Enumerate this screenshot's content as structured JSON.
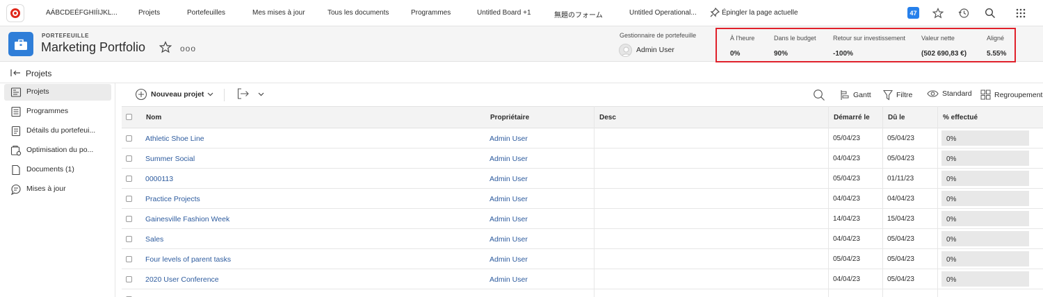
{
  "topnav": {
    "items": [
      "AÁBCDEÉFGHIÍIJKL...",
      "Projets",
      "Portefeuilles",
      "Mes mises à jour",
      "Tous les documents",
      "Programmes",
      "Untitled Board +1",
      "無題のフォーム",
      "Untitled Operational..."
    ],
    "pin_label": "Épingler la page actuelle",
    "notification_count": "47"
  },
  "header": {
    "kicker": "PORTEFEUILLE",
    "title": "Marketing Portfolio",
    "more": "ooo",
    "manager_label": "Gestionnaire de portefeuille",
    "manager_name": "Admin User",
    "metrics": [
      {
        "label": "À l'heure",
        "value": "0%"
      },
      {
        "label": "Dans le budget",
        "value": "90%"
      },
      {
        "label": "Retour sur investissement",
        "value": "-100%"
      },
      {
        "label": "Valeur nette",
        "value": "(502 690,83 €)"
      },
      {
        "label": "Aligné",
        "value": "5.55%"
      }
    ],
    "accent_color": "#e0202a"
  },
  "breadcrumb": {
    "label": "Projets"
  },
  "sidebar": {
    "items": [
      {
        "label": "Projets",
        "icon": "projects-icon",
        "active": true
      },
      {
        "label": "Programmes",
        "icon": "list-icon"
      },
      {
        "label": "Détails du portefeui...",
        "icon": "document-icon"
      },
      {
        "label": "Optimisation du po...",
        "icon": "optimizer-icon"
      },
      {
        "label": "Documents (1)",
        "icon": "file-icon"
      },
      {
        "label": "Mises à jour",
        "icon": "chat-icon"
      }
    ]
  },
  "toolbar": {
    "new_project": "Nouveau projet",
    "gantt": "Gantt",
    "filter": "Filtre",
    "view": "Standard",
    "grouping": "Regroupement"
  },
  "table": {
    "columns": [
      "Nom",
      "Propriétaire",
      "Desc",
      "Démarré le",
      "Dû le",
      "% effectué"
    ],
    "rows": [
      {
        "name": "Athletic Shoe Line",
        "owner": "Admin User",
        "start": "05/04/23",
        "due": "05/04/23",
        "pct": "0%"
      },
      {
        "name": "Summer Social",
        "owner": "Admin User",
        "start": "04/04/23",
        "due": "05/04/23",
        "pct": "0%"
      },
      {
        "name": "0000113",
        "owner": "Admin User",
        "start": "05/04/23",
        "due": "01/11/23",
        "pct": "0%"
      },
      {
        "name": "Practice Projects",
        "owner": "Admin User",
        "start": "04/04/23",
        "due": "04/04/23",
        "pct": "0%"
      },
      {
        "name": "Gainesville Fashion Week",
        "owner": "Admin User",
        "start": "14/04/23",
        "due": "15/04/23",
        "pct": "0%"
      },
      {
        "name": "Sales",
        "owner": "Admin User",
        "start": "04/04/23",
        "due": "05/04/23",
        "pct": "0%"
      },
      {
        "name": "Four levels of parent tasks",
        "owner": "Admin User",
        "start": "05/04/23",
        "due": "05/04/23",
        "pct": "0%"
      },
      {
        "name": "2020 User Conference",
        "owner": "Admin User",
        "start": "04/04/23",
        "due": "05/04/23",
        "pct": "0%"
      }
    ]
  }
}
